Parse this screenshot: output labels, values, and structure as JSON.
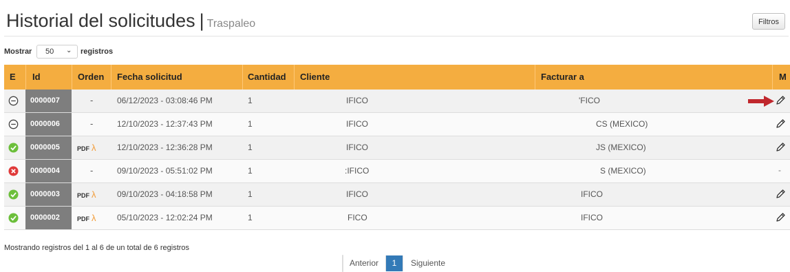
{
  "header": {
    "title": "Historial del solicitudes",
    "separator": "|",
    "subtitle": "Traspaleo",
    "filters_label": "Filtros"
  },
  "length_menu": {
    "show_label": "Mostrar",
    "selected_value": "50",
    "records_label": "registros"
  },
  "table": {
    "headers": [
      "E",
      "Id",
      "Orden",
      "Fecha solicitud",
      "Cantidad",
      "Cliente",
      "Facturar a",
      "M"
    ],
    "rows": [
      {
        "status": "pending",
        "id": "0000007",
        "orden": "-",
        "fecha": "06/12/2023 - 03:08:46 PM",
        "cantidad": "1",
        "cliente": "IFICO",
        "facturar": "'FICO",
        "edit": "pencil",
        "highlight_arrow": true
      },
      {
        "status": "pending",
        "id": "0000006",
        "orden": "-",
        "fecha": "12/10/2023 - 12:37:43 PM",
        "cantidad": "1",
        "cliente": "IFICO",
        "facturar": "CS (MEXICO)",
        "edit": "pencil",
        "highlight_arrow": false
      },
      {
        "status": "approved",
        "id": "0000005",
        "orden": "PDF",
        "fecha": "12/10/2023 - 12:36:28 PM",
        "cantidad": "1",
        "cliente": "IFICO",
        "facturar": "JS (MEXICO)",
        "edit": "pencil",
        "highlight_arrow": false
      },
      {
        "status": "rejected",
        "id": "0000004",
        "orden": "-",
        "fecha": "09/10/2023 - 05:51:02 PM",
        "cantidad": "1",
        "cliente": ":IFICO",
        "facturar": "S (MEXICO)",
        "edit": "-",
        "highlight_arrow": false
      },
      {
        "status": "approved",
        "id": "0000003",
        "orden": "PDF",
        "fecha": "09/10/2023 - 04:18:58 PM",
        "cantidad": "1",
        "cliente": "IFICO",
        "facturar": "IFICO",
        "edit": "pencil",
        "highlight_arrow": false
      },
      {
        "status": "approved",
        "id": "0000002",
        "orden": "PDF",
        "fecha": "05/10/2023 - 12:02:24 PM",
        "cantidad": "1",
        "cliente": "FICO",
        "facturar": "IFICO",
        "edit": "pencil",
        "highlight_arrow": false
      }
    ]
  },
  "footer": {
    "info": "Mostrando registros del 1 al 6 de un total de 6 registros",
    "prev_label": "Anterior",
    "current_page": "1",
    "next_label": "Siguiente"
  },
  "colors": {
    "header_bg": "#f4ad40",
    "id_cell_bg": "#7e7e7e",
    "approved": "#6cbf3b",
    "rejected": "#e03a3a",
    "pager_active": "#337ab7",
    "arrow": "#c0272d",
    "pdf_icon": "#f29c38"
  },
  "icons": {
    "pending": "clock-icon",
    "approved": "check-circle-icon",
    "rejected": "x-circle-icon",
    "edit": "pencil-icon",
    "pdf": "pdf-icon",
    "highlight": "red-arrow-icon"
  }
}
